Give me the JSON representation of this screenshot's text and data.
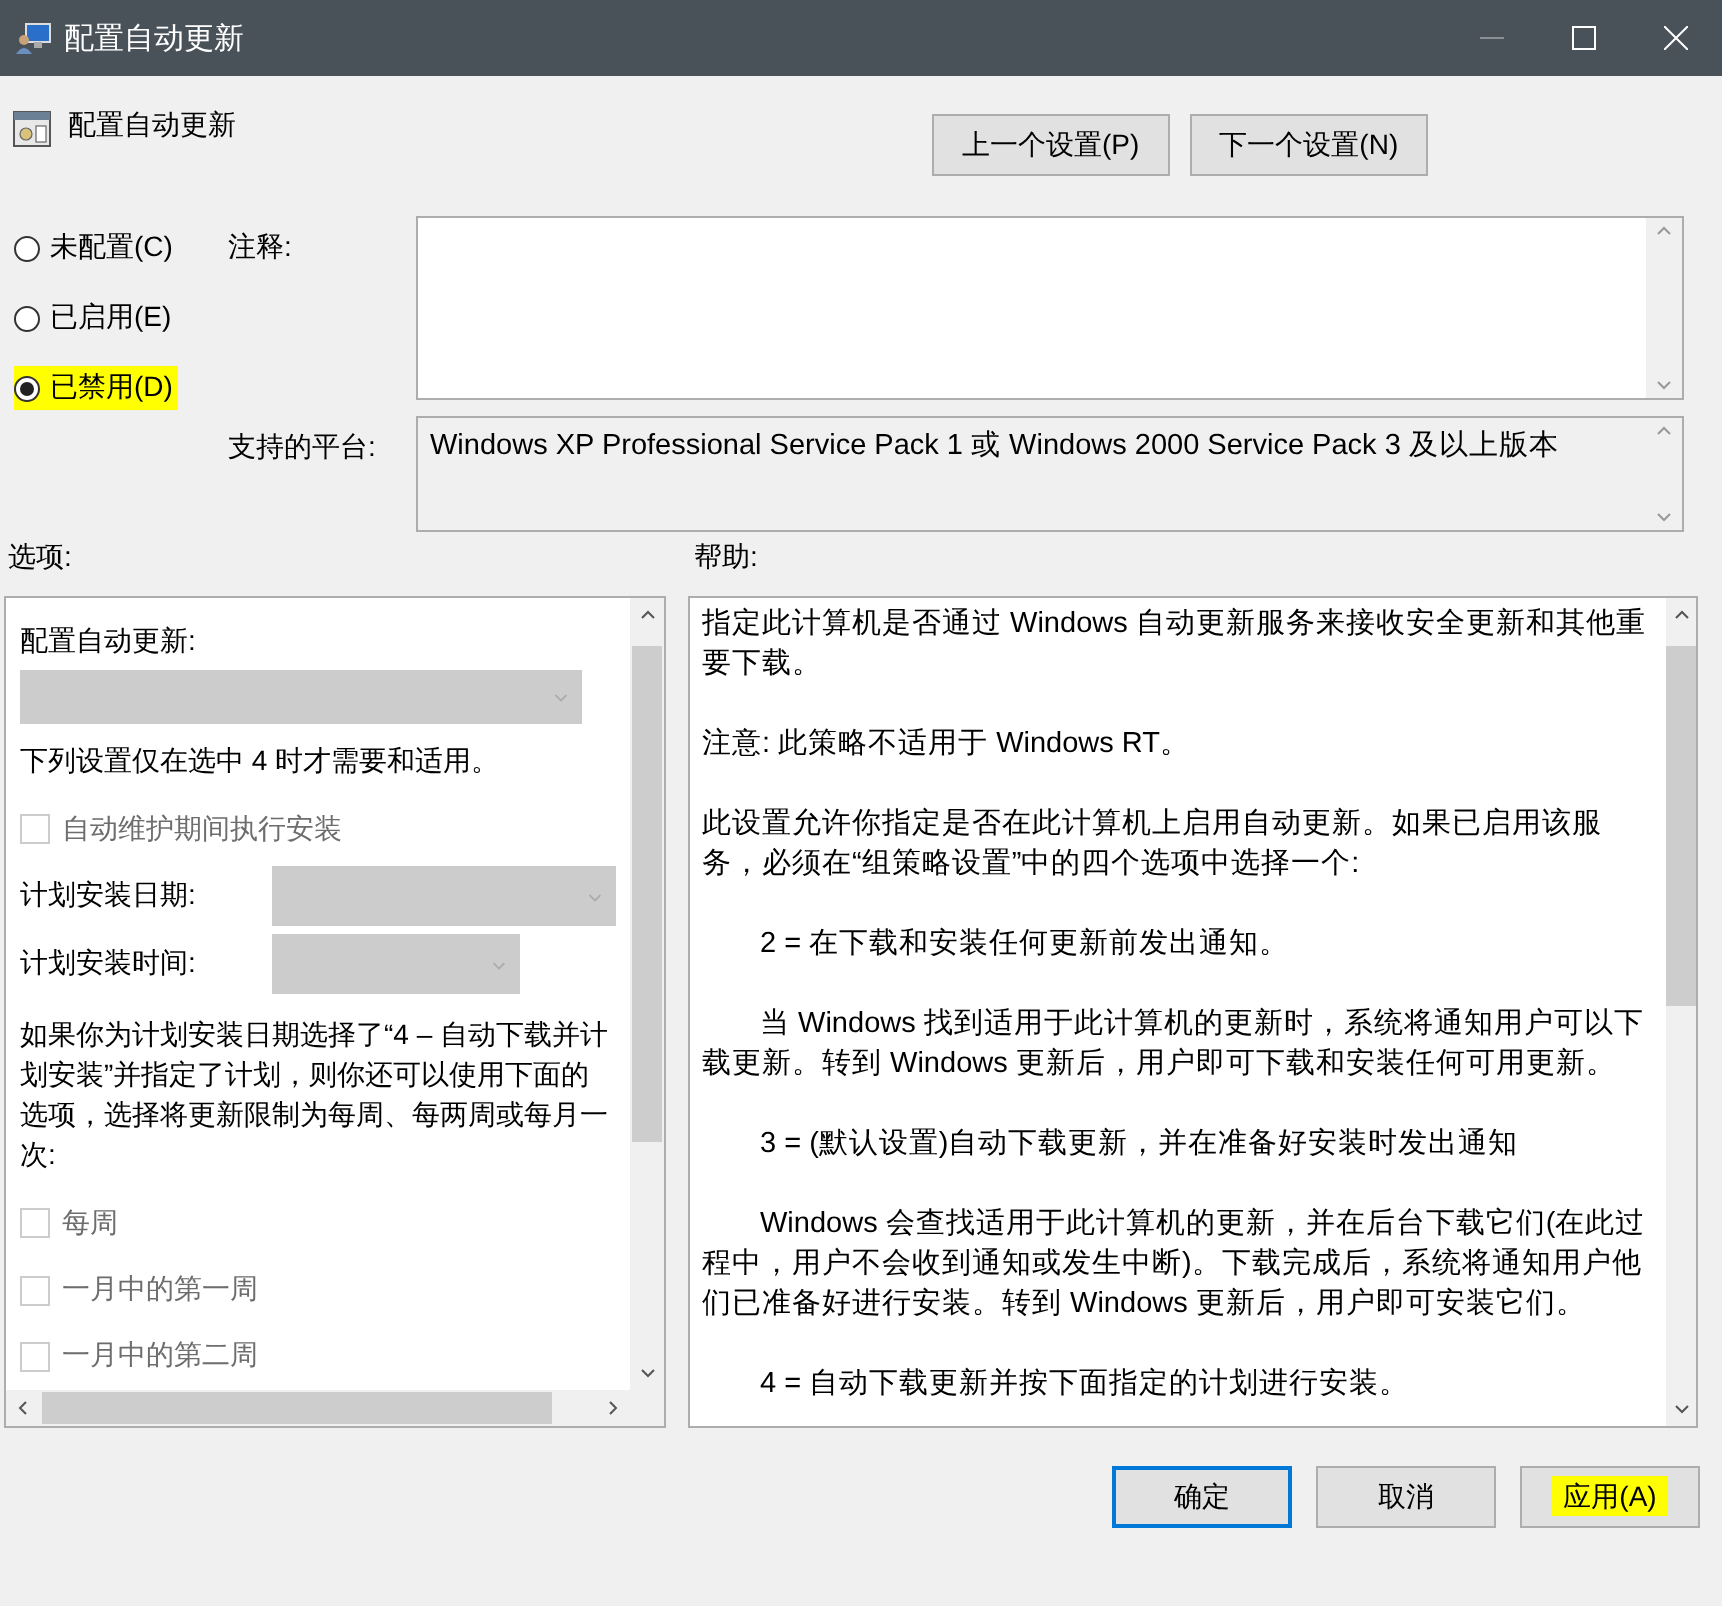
{
  "window": {
    "title": "配置自动更新"
  },
  "header": {
    "title": "配置自动更新",
    "buttons": [
      {
        "label": "上一个设置(P)"
      },
      {
        "label": "下一个设置(N)"
      }
    ]
  },
  "state_options": [
    {
      "label": "未配置(C)",
      "selected": false,
      "highlighted": false
    },
    {
      "label": "已启用(E)",
      "selected": false,
      "highlighted": false
    },
    {
      "label": "已禁用(D)",
      "selected": true,
      "highlighted": true
    }
  ],
  "comment": {
    "label": "注释:"
  },
  "platform": {
    "label": "支持的平台:",
    "value": "Windows XP Professional Service Pack 1 或 Windows 2000 Service Pack 3 及以上版本"
  },
  "options": {
    "label": "选项:",
    "items": [
      {
        "kind": "label",
        "text": "配置自动更新:"
      },
      {
        "kind": "dropdown",
        "disabled": true
      },
      {
        "kind": "text",
        "text": "下列设置仅在选中 4 时才需要和适用。"
      },
      {
        "kind": "checkbox",
        "text": "自动维护期间执行安装",
        "checked": false,
        "disabled": true
      },
      {
        "kind": "labeled-dropdown",
        "text": "计划安装日期:",
        "disabled": true
      },
      {
        "kind": "labeled-dropdown",
        "text": "计划安装时间:",
        "disabled": true
      },
      {
        "kind": "text",
        "text": "如果你为计划安装日期选择了“4 – 自动下载并计划安装”并指定了计划，则你还可以使用下面的选项，选择将更新限制为每周、每两周或每月一次:"
      },
      {
        "kind": "checkbox",
        "text": "每周",
        "checked": false,
        "disabled": true
      },
      {
        "kind": "checkbox",
        "text": "一月中的第一周",
        "checked": false,
        "disabled": true
      },
      {
        "kind": "checkbox",
        "text": "一月中的第二周",
        "checked": false,
        "disabled": true
      }
    ]
  },
  "help": {
    "label": "帮助:",
    "paragraphs": [
      {
        "kind": "plain",
        "text": "指定此计算机是否通过 Windows 自动更新服务来接收安全更新和其他重要下载。"
      },
      {
        "kind": "plain",
        "text": "注意: 此策略不适用于 Windows RT。"
      },
      {
        "kind": "plain",
        "text": "此设置允许你指定是否在此计算机上启用自动更新。如果已启用该服务，必须在“组策略设置”中的四个选项中选择一个:"
      },
      {
        "kind": "indented",
        "text": "2 = 在下载和安装任何更新前发出通知。"
      },
      {
        "kind": "indented",
        "text": "当 Windows 找到适用于此计算机的更新时，系统将通知用户可以下载更新。转到 Windows 更新后，用户即可下载和安装任何可用更新。"
      },
      {
        "kind": "indented",
        "text": "3 = (默认设置)自动下载更新，并在准备好安装时发出通知"
      },
      {
        "kind": "indented",
        "text": "Windows 会查找适用于此计算机的更新，并在后台下载它们(在此过程中，用户不会收到通知或发生中断)。下载完成后，系统将通知用户他们已准备好进行安装。转到 Windows 更新后，用户即可安装它们。"
      },
      {
        "kind": "indented",
        "text": "4 = 自动下载更新并按下面指定的计划进行安装。"
      }
    ]
  },
  "footer": {
    "buttons": [
      {
        "label": "确定",
        "default": true,
        "highlighted": false
      },
      {
        "label": "取消",
        "default": false,
        "highlighted": false
      },
      {
        "label": "应用(A)",
        "default": false,
        "highlighted": true
      }
    ]
  }
}
